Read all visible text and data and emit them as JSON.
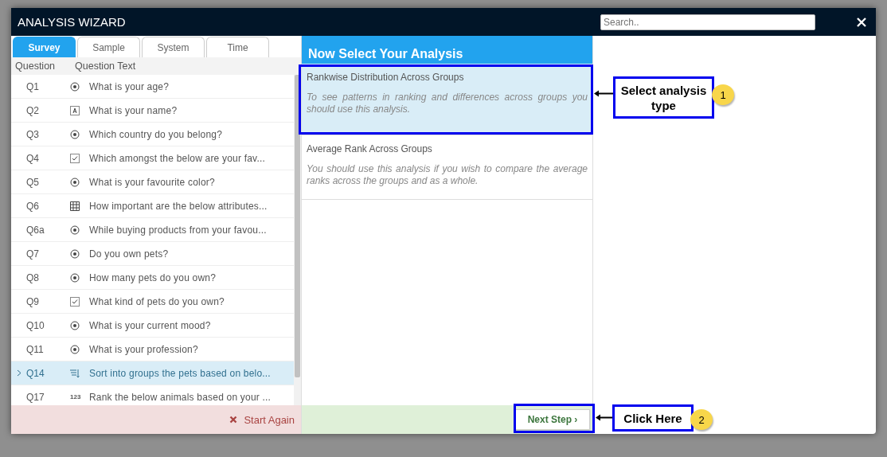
{
  "window": {
    "title": "ANALYSIS WIZARD",
    "search": {
      "placeholder": "Search.."
    }
  },
  "tabs": [
    {
      "label": "Survey",
      "selected": true
    },
    {
      "label": "Sample",
      "selected": false
    },
    {
      "label": "System",
      "selected": false
    },
    {
      "label": "Time",
      "selected": false
    }
  ],
  "questions": {
    "columns": [
      "Question",
      "Question Text"
    ],
    "rows": [
      {
        "id": "Q1",
        "kind": "radio",
        "text": "What is your age?",
        "selected": false
      },
      {
        "id": "Q2",
        "kind": "text",
        "text": "What is your name?",
        "selected": false
      },
      {
        "id": "Q3",
        "kind": "radio",
        "text": "Which country do you belong?",
        "selected": false
      },
      {
        "id": "Q4",
        "kind": "checkbox",
        "text": "Which amongst the below are your fav...",
        "selected": false
      },
      {
        "id": "Q5",
        "kind": "radio",
        "text": "What is your favourite color?",
        "selected": false
      },
      {
        "id": "Q6",
        "kind": "grid",
        "text": "How important are the below attributes...",
        "selected": false
      },
      {
        "id": "Q6a",
        "kind": "radio",
        "text": "While buying products from your favou...",
        "selected": false
      },
      {
        "id": "Q7",
        "kind": "radio",
        "text": "Do you own pets?",
        "selected": false
      },
      {
        "id": "Q8",
        "kind": "radio",
        "text": "How many pets do you own?",
        "selected": false
      },
      {
        "id": "Q9",
        "kind": "checkbox",
        "text": "What kind of pets do you own?",
        "selected": false
      },
      {
        "id": "Q10",
        "kind": "radio",
        "text": "What is your current mood?",
        "selected": false
      },
      {
        "id": "Q11",
        "kind": "radio",
        "text": "What is your profession?",
        "selected": false
      },
      {
        "id": "Q14",
        "kind": "sort",
        "text": "Sort into groups the pets based on belo...",
        "selected": true
      },
      {
        "id": "Q17",
        "kind": "number",
        "number_label": "123",
        "text": "Rank the below animals based on your ...",
        "selected": false
      }
    ]
  },
  "start_again": "Start Again",
  "analysis": {
    "title": "Now Select Your Analysis",
    "options": [
      {
        "name": "Rankwise Distribution Across Groups",
        "description": "To see patterns in ranking and differences across groups you should use this analysis.",
        "selected": true
      },
      {
        "name": "Average Rank Across Groups",
        "description": "You should use this analysis if you wish to compare the average ranks across the groups and as a whole.",
        "selected": false
      }
    ]
  },
  "next_step": "Next Step ›",
  "callouts": [
    {
      "text": "Select analysis type",
      "badge": "1"
    },
    {
      "text": "Click Here",
      "badge": "2"
    }
  ]
}
